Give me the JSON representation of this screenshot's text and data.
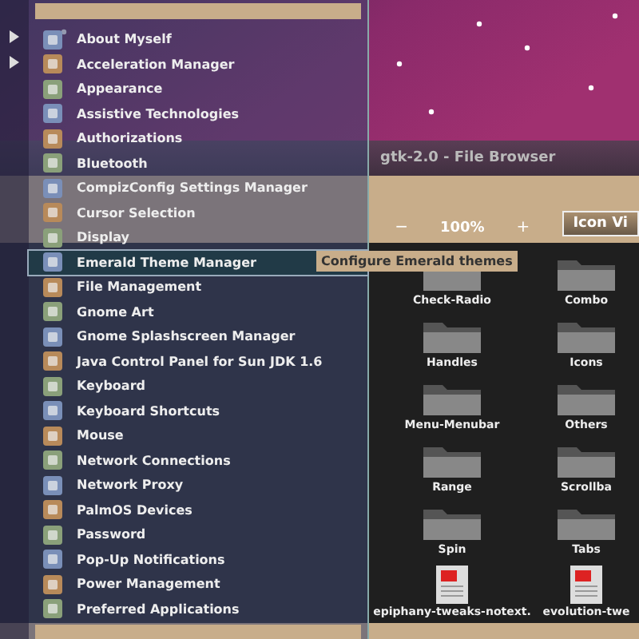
{
  "file_browser": {
    "title": "gtk-2.0 - File Browser",
    "zoom_out": "−",
    "zoom_level": "100%",
    "zoom_in": "+",
    "view_button": "Icon Vi",
    "items": [
      {
        "name": "Check-Radio",
        "kind": "folder"
      },
      {
        "name": "Combo",
        "kind": "folder"
      },
      {
        "name": "Handles",
        "kind": "folder"
      },
      {
        "name": "Icons",
        "kind": "folder"
      },
      {
        "name": "Menu-Menubar",
        "kind": "folder"
      },
      {
        "name": "Others",
        "kind": "folder"
      },
      {
        "name": "Range",
        "kind": "folder"
      },
      {
        "name": "Scrollba",
        "kind": "folder"
      },
      {
        "name": "Spin",
        "kind": "folder"
      },
      {
        "name": "Tabs",
        "kind": "folder"
      },
      {
        "name": "epiphany-tweaks-notext.",
        "kind": "file"
      },
      {
        "name": "evolution-twe",
        "kind": "file"
      }
    ]
  },
  "menu": {
    "items": [
      {
        "label": "About Myself",
        "selected": false
      },
      {
        "label": "Acceleration Manager",
        "selected": false
      },
      {
        "label": "Appearance",
        "selected": false
      },
      {
        "label": "Assistive Technologies",
        "selected": false
      },
      {
        "label": "Authorizations",
        "selected": false
      },
      {
        "label": "Bluetooth",
        "selected": false
      },
      {
        "label": "CompizConfig Settings Manager",
        "selected": false
      },
      {
        "label": "Cursor Selection",
        "selected": false
      },
      {
        "label": "Display",
        "selected": false
      },
      {
        "label": "Emerald Theme Manager",
        "selected": true
      },
      {
        "label": "File Management",
        "selected": false
      },
      {
        "label": "Gnome Art",
        "selected": false
      },
      {
        "label": "Gnome Splashscreen Manager",
        "selected": false
      },
      {
        "label": "Java Control Panel for Sun JDK 1.6",
        "selected": false
      },
      {
        "label": "Keyboard",
        "selected": false
      },
      {
        "label": "Keyboard Shortcuts",
        "selected": false
      },
      {
        "label": "Mouse",
        "selected": false
      },
      {
        "label": "Network Connections",
        "selected": false
      },
      {
        "label": "Network Proxy",
        "selected": false
      },
      {
        "label": "PalmOS Devices",
        "selected": false
      },
      {
        "label": "Password",
        "selected": false
      },
      {
        "label": "Pop-Up Notifications",
        "selected": false
      },
      {
        "label": "Power Management",
        "selected": false
      },
      {
        "label": "Preferred Applications",
        "selected": false
      }
    ]
  },
  "tooltip": "Configure Emerald themes"
}
